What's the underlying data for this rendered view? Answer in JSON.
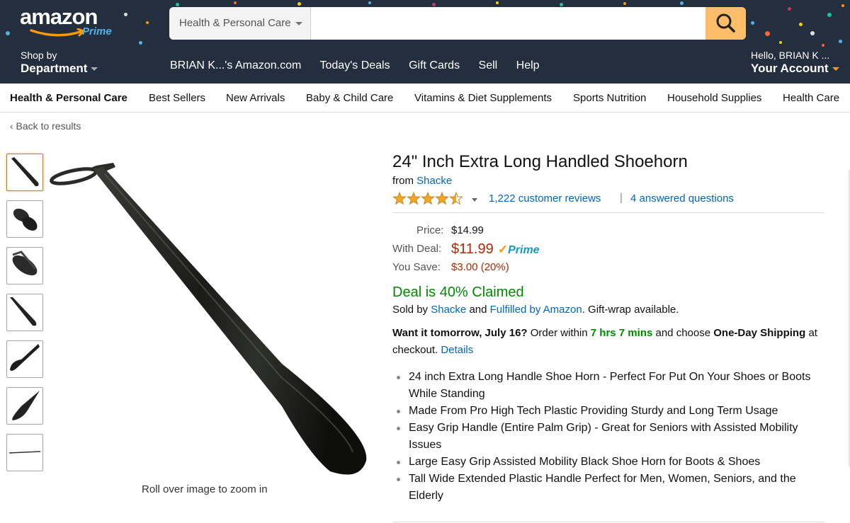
{
  "header": {
    "logo_text": "amazon",
    "logo_prime": "Prime",
    "search_category": "Health & Personal Care",
    "search_value": "",
    "shop_by_line1": "Shop by",
    "shop_by_line2": "Department",
    "nav_links": [
      "BRIAN K...'s Amazon.com",
      "Today's Deals",
      "Gift Cards",
      "Sell",
      "Help"
    ],
    "account_line1": "Hello, BRIAN K ...",
    "account_line2": "Your Account",
    "colors": {
      "bg": "#232f3e",
      "search_button": "#febd69",
      "accent": "#ff9900"
    }
  },
  "subnav": {
    "items": [
      "Health & Personal Care",
      "Best Sellers",
      "New Arrivals",
      "Baby & Child Care",
      "Vitamins & Diet Supplements",
      "Sports Nutrition",
      "Household Supplies",
      "Health Care"
    ]
  },
  "back_link": "‹ Back to results",
  "gallery": {
    "thumbnail_count": 7,
    "selected_index": 0,
    "zoom_hint": "Roll over image to zoom in"
  },
  "product": {
    "title": "24\" Inch Extra Long Handled Shoehorn",
    "from_label": "from",
    "brand": "Shacke",
    "rating": 4.5,
    "reviews": "1,222 customer reviews",
    "separator": "|",
    "answered": "4 answered questions",
    "price_label": "Price:",
    "price": "$14.99",
    "deal_label": "With Deal:",
    "deal_price": "$11.99",
    "prime_label": "Prime",
    "save_label": "You Save:",
    "save_value": "$3.00 (20%)",
    "deal_claimed": "Deal is 40% Claimed",
    "sold_by_prefix": "Sold by",
    "seller": "Shacke",
    "and_text": "and",
    "fulfilled": "Fulfilled by Amazon",
    "giftwrap": ". Gift-wrap available.",
    "delivery_bold1": "Want it tomorrow, July 16?",
    "delivery_text1": "Order within",
    "delivery_time": "7 hrs 7 mins",
    "delivery_text2": "and choose",
    "delivery_bold2": "One-Day Shipping",
    "delivery_text3": "at checkout.",
    "details_link": "Details",
    "bullets": [
      "24 inch Extra Long Handle Shoe Horn - Perfect For Put On Your Shoes or Boots While Standing",
      "Made From Pro High Tech Plastic Providing Sturdy and Long Term Usage",
      "Easy Grip Handle (Entire Palm Grip) - Great for Seniors with Assisted Mobility Issues",
      "Large Easy Grip Assisted Mobility Black Shoe Horn for Boots & Shoes",
      "Tall Wide Extended Plastic Handle Perfect for Men, Women, Seniors, and the Elderly"
    ]
  }
}
